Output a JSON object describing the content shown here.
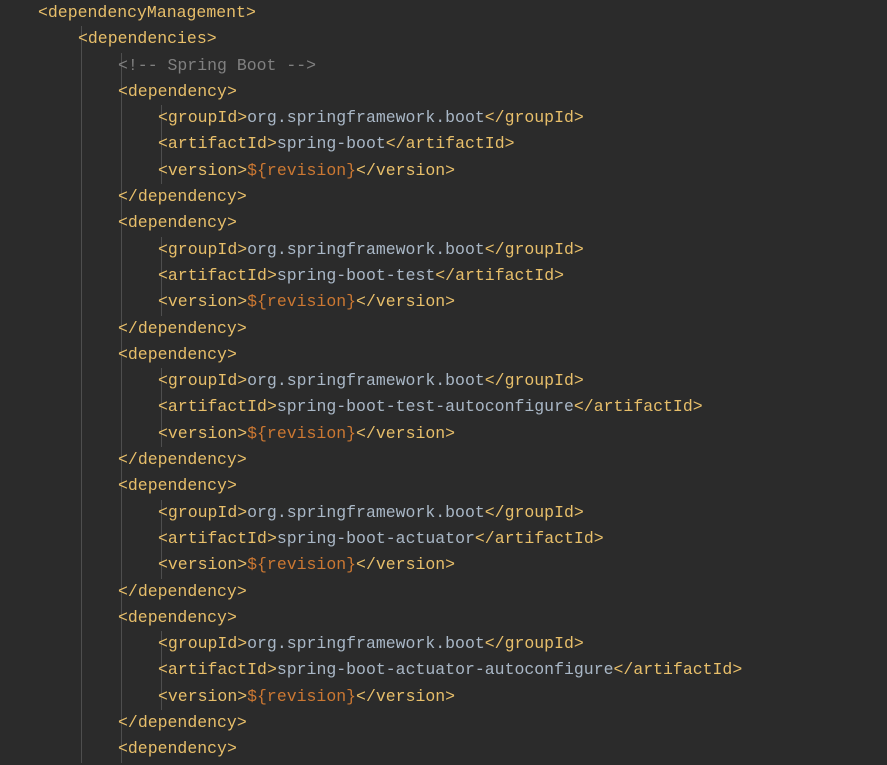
{
  "dependencyManagement": {
    "tag": "dependencyManagement",
    "dependenciesTag": "dependencies",
    "comment": "<!-- Spring Boot -->",
    "dependencyTag": "dependency",
    "groupIdTag": "groupId",
    "artifactIdTag": "artifactId",
    "versionTag": "version",
    "revision": "${revision}",
    "dependencies": [
      {
        "groupId": "org.springframework.boot",
        "artifactId": "spring-boot"
      },
      {
        "groupId": "org.springframework.boot",
        "artifactId": "spring-boot-test"
      },
      {
        "groupId": "org.springframework.boot",
        "artifactId": "spring-boot-test-autoconfigure"
      },
      {
        "groupId": "org.springframework.boot",
        "artifactId": "spring-boot-actuator"
      },
      {
        "groupId": "org.springframework.boot",
        "artifactId": "spring-boot-actuator-autoconfigure"
      }
    ]
  },
  "indent": {
    "base": 38,
    "step": 40
  }
}
